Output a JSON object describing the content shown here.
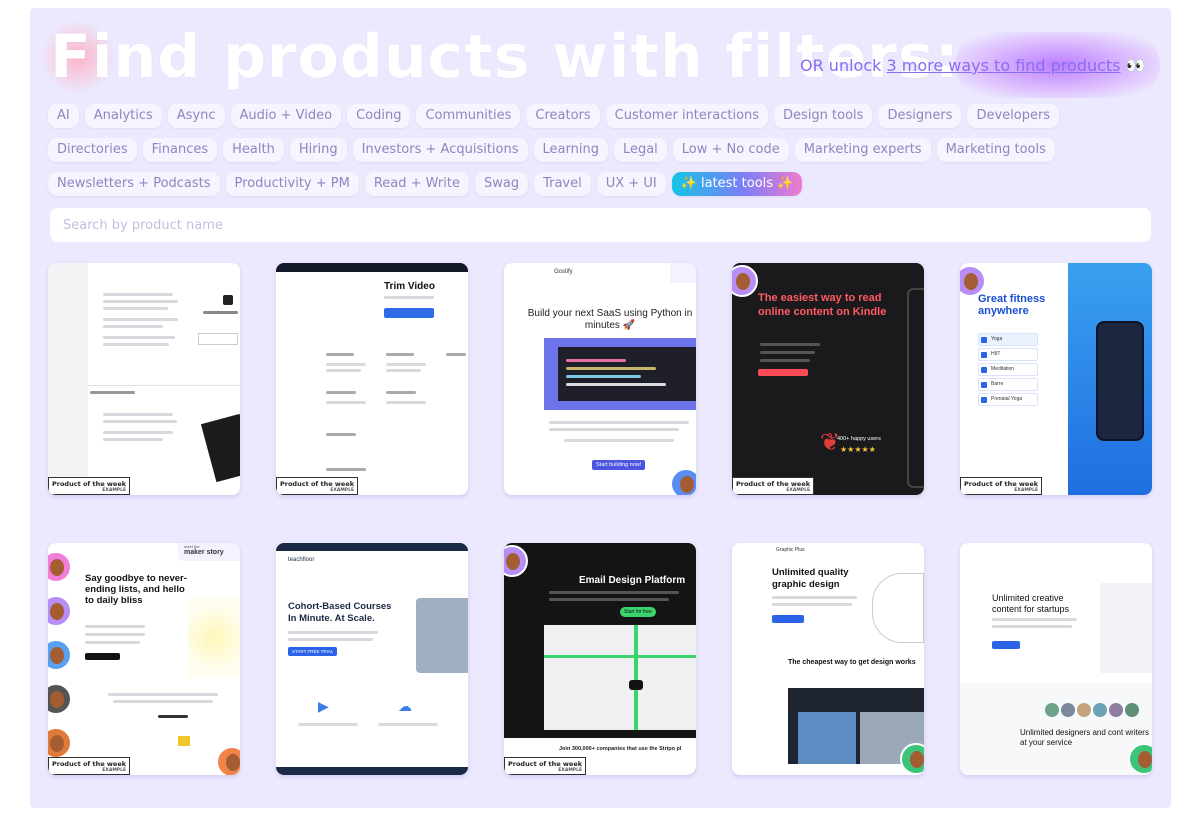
{
  "hero": {
    "title": "Find products with filters:",
    "or_text": "OR unlock ",
    "unlock_link": "3 more ways to find products",
    "eyes": "👀"
  },
  "tags": [
    "AI",
    "Analytics",
    "Async",
    "Audio + Video",
    "Coding",
    "Communities",
    "Creators",
    "Customer interactions",
    "Design tools",
    "Designers",
    "Developers",
    "Directories",
    "Finances",
    "Health",
    "Hiring",
    "Investors + Acquisitions",
    "Learning",
    "Legal",
    "Low + No code",
    "Marketing experts",
    "Marketing tools",
    "Newsletters + Podcasts",
    "Productivity + PM",
    "Read + Write",
    "Swag",
    "Travel",
    "UX + UI"
  ],
  "latest_tag": "✨ latest tools ✨",
  "search": {
    "placeholder": "Search by product name"
  },
  "badge": {
    "label": "Product of the week",
    "sub": "EXAMPLE"
  },
  "maker_story": {
    "top": "meet the",
    "main": "maker story"
  },
  "cards": {
    "trim": {
      "title": "Trim Video"
    },
    "saas": {
      "brand": "Gostify",
      "headline": "Build your next SaaS using Python in minutes 🚀",
      "cta": "Start building now!"
    },
    "kindle": {
      "headline": "The easiest way to read online content on Kindle",
      "users": "400+ happy users"
    },
    "fitness": {
      "headline": "Great fitness anywhere",
      "items": [
        "Yoga",
        "HIIT",
        "Meditation",
        "Barre",
        "Prenatal Yoga"
      ]
    },
    "todo": {
      "headline": "Say goodbye to never-ending lists, and hello to daily bliss"
    },
    "teach": {
      "brand": "teachfloor",
      "headline": "Cohort-Based Courses In Minute. At Scale.",
      "cta": "START FREE TRIAL"
    },
    "email": {
      "headline": "Email Design Platform",
      "cta": "Start for free",
      "footer": "Join 300,000+ companies that use the Stripo pl"
    },
    "graphic": {
      "brand": "Graphic Plus",
      "headline": "Unlimited quality graphic design",
      "sub": "The cheapest way to get design works"
    },
    "creative": {
      "headline": "Unlimited creative content for startups",
      "sub": "Unlimited designers and cont writers at your service"
    }
  },
  "colors": {
    "background": "#ece9fe",
    "tag_text": "#8e86bf",
    "accent": "#8a6cf2"
  }
}
